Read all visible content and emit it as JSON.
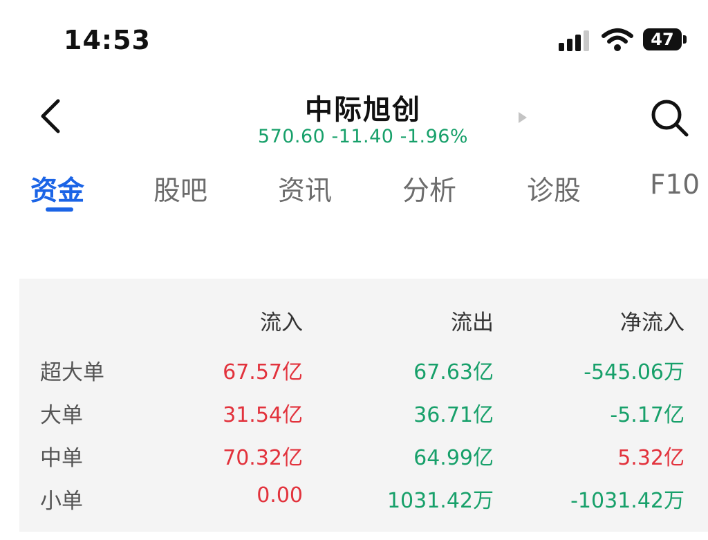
{
  "status_bar": {
    "time": "14:53",
    "battery": "47",
    "icons": [
      "signal-icon",
      "wifi-icon",
      "battery-icon"
    ]
  },
  "header": {
    "title": "中际旭创",
    "quote": "570.60 -11.40 -1.96%",
    "icons": [
      "back-icon",
      "next-arrow-icon",
      "search-icon"
    ]
  },
  "tabs": [
    {
      "label": "资金",
      "active": true
    },
    {
      "label": "股吧"
    },
    {
      "label": "资讯"
    },
    {
      "label": "分析"
    },
    {
      "label": "诊股"
    },
    {
      "label": "F10"
    }
  ],
  "fund_flow": {
    "columns": [
      "流入",
      "流出",
      "净流入"
    ],
    "rows": [
      {
        "label": "超大单",
        "inflow": "67.57亿",
        "outflow": "67.63亿",
        "net": "-545.06万"
      },
      {
        "label": "大单",
        "inflow": "31.54亿",
        "outflow": "36.71亿",
        "net": "-5.17亿"
      },
      {
        "label": "中单",
        "inflow": "70.32亿",
        "outflow": "64.99亿",
        "net": "5.32亿"
      },
      {
        "label": "小单",
        "inflow": "0.00",
        "outflow": "1031.42万",
        "net": "-1031.42万"
      }
    ]
  },
  "colors": {
    "accent": "#1b64e6",
    "up": "#e2323c",
    "down": "#17a06a",
    "panel_bg": "#f4f4f4"
  }
}
